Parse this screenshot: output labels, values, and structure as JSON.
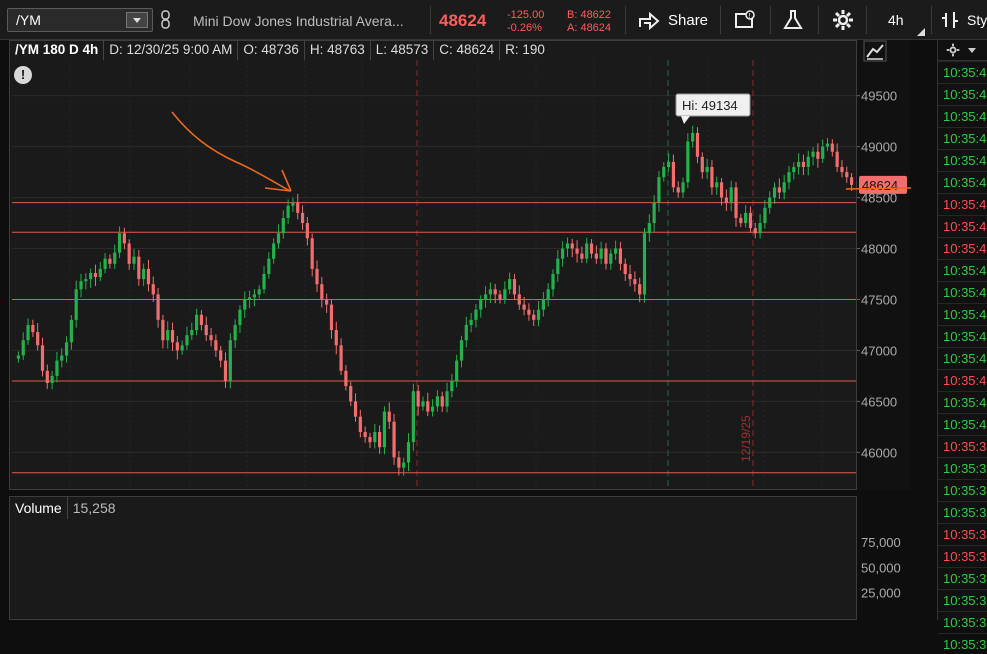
{
  "toolbar": {
    "symbol": "/YM",
    "description": "Mini Dow Jones Industrial Avera...",
    "last": "48624",
    "change": "-125.00",
    "change_pct": "-0.26%",
    "bid": "B: 48622",
    "ask": "A: 48624",
    "share_label": "Share",
    "timeframe": "4h",
    "style_label": "Sty"
  },
  "chart": {
    "header": "/YM 180 D 4h",
    "date": "D: 12/30/25 9:00 AM",
    "open": "O: 48736",
    "high": "H: 48763",
    "low": "L: 48573",
    "close": "C: 48624",
    "range": "R: 190",
    "hi_bubble": "Hi: 49134",
    "price_tag": "48624",
    "vertical_label": "12/19/25",
    "marker_label": "",
    "price_ticks": [
      "49500",
      "49000",
      "48500",
      "48000",
      "47500",
      "47000",
      "46500",
      "46000"
    ],
    "support_levels": [
      48450,
      48160,
      47500,
      46700,
      45800
    ],
    "colors": {
      "up": "#22b14c",
      "down": "#f26d6d",
      "level": "#e05a4a",
      "annotation": "#e9691e"
    }
  },
  "chart_data": {
    "type": "candlestick",
    "title": "/YM 180 D 4h",
    "ylim": [
      45650,
      49850
    ],
    "close": [
      46950,
      47100,
      47250,
      47180,
      47050,
      46800,
      46680,
      46750,
      46900,
      46950,
      47080,
      47300,
      47600,
      47680,
      47700,
      47760,
      47720,
      47800,
      47900,
      47850,
      47960,
      48150,
      48050,
      47850,
      47920,
      47700,
      47800,
      47650,
      47550,
      47300,
      47100,
      47200,
      47080,
      47000,
      47050,
      47150,
      47200,
      47350,
      47250,
      47150,
      47100,
      47000,
      46900,
      46700,
      47100,
      47250,
      47400,
      47500,
      47520,
      47550,
      47600,
      47750,
      47900,
      48050,
      48150,
      48300,
      48420,
      48450,
      48350,
      48250,
      48100,
      47800,
      47650,
      47500,
      47450,
      47200,
      47050,
      46800,
      46650,
      46500,
      46350,
      46200,
      46150,
      46100,
      46200,
      46050,
      46400,
      46300,
      45950,
      45850,
      45900,
      46100,
      46600,
      46450,
      46500,
      46400,
      46450,
      46550,
      46450,
      46600,
      46700,
      46900,
      47100,
      47250,
      47300,
      47400,
      47500,
      47550,
      47600,
      47550,
      47500,
      47600,
      47700,
      47550,
      47450,
      47400,
      47350,
      47300,
      47400,
      47500,
      47600,
      47750,
      47900,
      48000,
      48050,
      48000,
      47950,
      47900,
      48050,
      47950,
      47900,
      48000,
      47850,
      47950,
      48000,
      47850,
      47750,
      47700,
      47650,
      47550,
      48150,
      48250,
      48450,
      48700,
      48800,
      48850,
      48600,
      48550,
      48650,
      49050,
      49134,
      48900,
      48750,
      48800,
      48600,
      48650,
      48500,
      48450,
      48600,
      48300,
      48250,
      48350,
      48200,
      48150,
      48250,
      48400,
      48500,
      48600,
      48550,
      48650,
      48750,
      48800,
      48850,
      48800,
      48900,
      48950,
      48880,
      49000,
      49030,
      48950,
      48800,
      48750,
      48700,
      48624
    ],
    "volume_ticks": [
      "75,000",
      "50,000",
      "25,000"
    ],
    "volume_value": "15,258",
    "volume_max": 95000
  },
  "volume": {
    "label": "Volume",
    "value": "15,258"
  },
  "tape": {
    "rows": [
      {
        "t": "10:35:4",
        "c": "#2ecc40"
      },
      {
        "t": "10:35:4",
        "c": "#2ecc40"
      },
      {
        "t": "10:35:4",
        "c": "#2ecc40"
      },
      {
        "t": "10:35:4",
        "c": "#2ecc40"
      },
      {
        "t": "10:35:4",
        "c": "#2ecc40"
      },
      {
        "t": "10:35:4",
        "c": "#2ecc40"
      },
      {
        "t": "10:35:4",
        "c": "#ff4d4d"
      },
      {
        "t": "10:35:4",
        "c": "#ff4d4d"
      },
      {
        "t": "10:35:4",
        "c": "#ff4d4d"
      },
      {
        "t": "10:35:4",
        "c": "#2ecc40"
      },
      {
        "t": "10:35:4",
        "c": "#2ecc40"
      },
      {
        "t": "10:35:4",
        "c": "#2ecc40"
      },
      {
        "t": "10:35:4",
        "c": "#2ecc40"
      },
      {
        "t": "10:35:4",
        "c": "#2ecc40"
      },
      {
        "t": "10:35:4",
        "c": "#ff4d4d"
      },
      {
        "t": "10:35:4",
        "c": "#2ecc40"
      },
      {
        "t": "10:35:4",
        "c": "#2ecc40"
      },
      {
        "t": "10:35:3",
        "c": "#ff4d4d"
      },
      {
        "t": "10:35:3",
        "c": "#2ecc40"
      },
      {
        "t": "10:35:3",
        "c": "#2ecc40"
      },
      {
        "t": "10:35:3",
        "c": "#2ecc40"
      },
      {
        "t": "10:35:3",
        "c": "#ff4d4d"
      },
      {
        "t": "10:35:3",
        "c": "#ff4d4d"
      },
      {
        "t": "10:35:3",
        "c": "#2ecc40"
      },
      {
        "t": "10:35:3",
        "c": "#2ecc40"
      },
      {
        "t": "10:35:3",
        "c": "#2ecc40"
      },
      {
        "t": "10:35:3",
        "c": "#2ecc40"
      }
    ]
  }
}
